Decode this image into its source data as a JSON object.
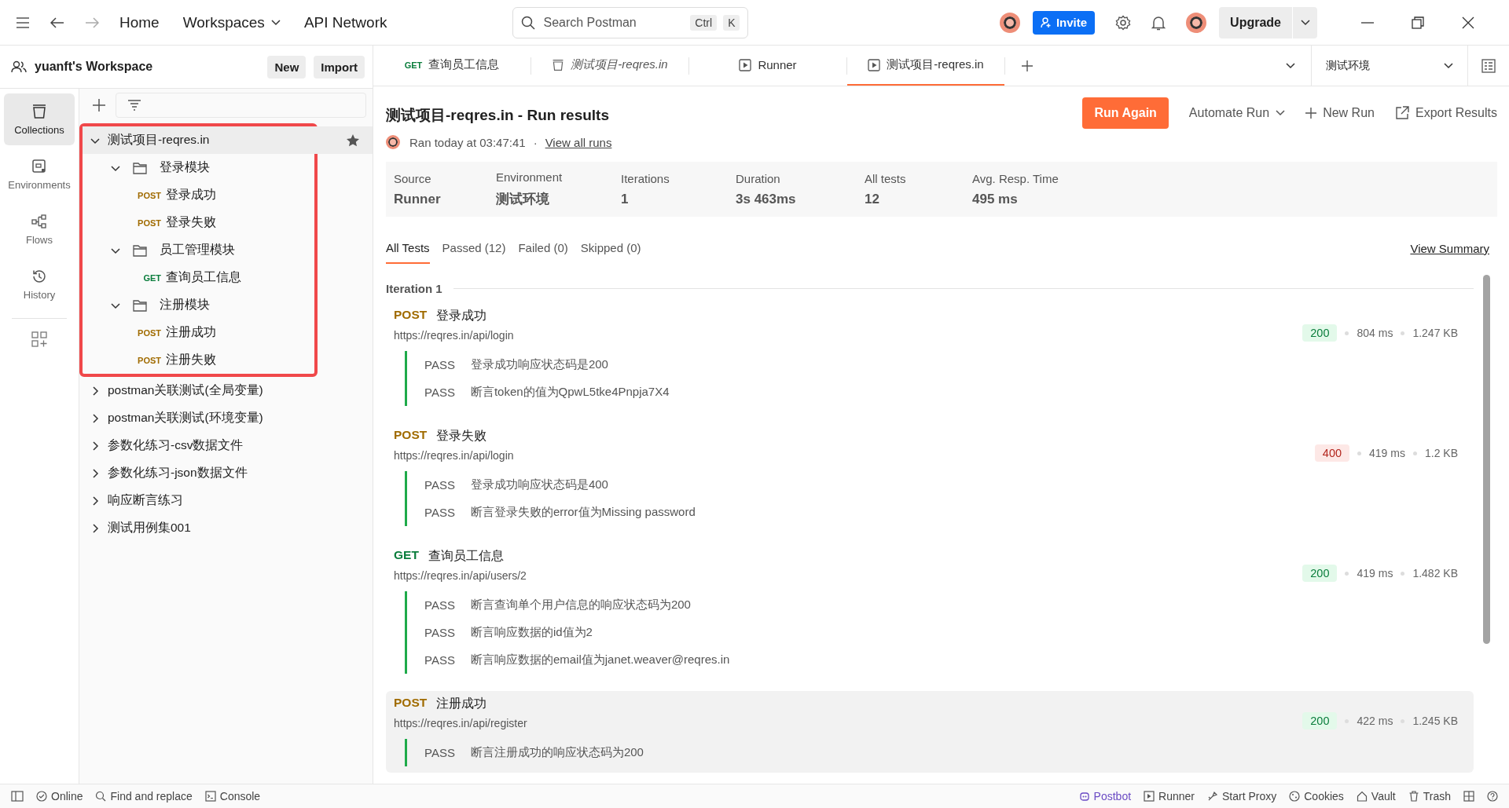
{
  "topbar": {
    "nav": [
      "Home",
      "Workspaces",
      "API Network"
    ],
    "search": {
      "placeholder": "Search Postman",
      "keys": [
        "Ctrl",
        "K"
      ]
    },
    "invite": "Invite",
    "upgrade": "Upgrade"
  },
  "workspace": {
    "name": "yuanft's Workspace",
    "buttons": [
      "New",
      "Import"
    ]
  },
  "rail": [
    {
      "label": "Collections",
      "selected": true,
      "kind": "collections"
    },
    {
      "label": "Environments",
      "selected": false,
      "kind": "environments"
    },
    {
      "label": "Flows",
      "selected": false,
      "kind": "flows"
    },
    {
      "label": "History",
      "selected": false,
      "kind": "history"
    }
  ],
  "collections": [
    {
      "name": "测试项目-reqres.in",
      "expanded": true,
      "highlighted": true,
      "starred": true,
      "children": [
        {
          "kind": "folder",
          "name": "登录模块",
          "expanded": true,
          "children": [
            {
              "kind": "request",
              "method": "POST",
              "name": "登录成功"
            },
            {
              "kind": "request",
              "method": "POST",
              "name": "登录失败"
            }
          ]
        },
        {
          "kind": "folder",
          "name": "员工管理模块",
          "expanded": true,
          "children": [
            {
              "kind": "request",
              "method": "GET",
              "name": "查询员工信息"
            }
          ]
        },
        {
          "kind": "folder",
          "name": "注册模块",
          "expanded": true,
          "children": [
            {
              "kind": "request",
              "method": "POST",
              "name": "注册成功"
            },
            {
              "kind": "request",
              "method": "POST",
              "name": "注册失败"
            }
          ]
        }
      ]
    },
    {
      "name": "postman关联测试(全局变量)",
      "expanded": false,
      "highlighted": false,
      "starred": false
    },
    {
      "name": "postman关联测试(环境变量)",
      "expanded": false,
      "highlighted": false,
      "starred": false
    },
    {
      "name": "参数化练习-csv数据文件",
      "expanded": false,
      "highlighted": false,
      "starred": false
    },
    {
      "name": "参数化练习-json数据文件",
      "expanded": false,
      "highlighted": false,
      "starred": false
    },
    {
      "name": "响应断言练习",
      "expanded": false,
      "highlighted": false,
      "starred": false
    },
    {
      "name": "测试用例集001",
      "expanded": false,
      "highlighted": false,
      "starred": false
    }
  ],
  "tabs": [
    {
      "kind": "request",
      "method": "GET",
      "title": "查询员工信息",
      "preview": false,
      "selected": false
    },
    {
      "kind": "collection",
      "title": "测试项目-reqres.in",
      "preview": true,
      "selected": false
    },
    {
      "kind": "runner",
      "title": "Runner",
      "preview": false,
      "selected": false
    },
    {
      "kind": "runner",
      "title": "测试项目-reqres.in",
      "preview": false,
      "selected": true
    }
  ],
  "environment": "测试环境",
  "run": {
    "title": "测试项目-reqres.in - Run results",
    "ran": "Ran today at 03:47:41",
    "separator": "·",
    "view_all": "View all runs",
    "actions": {
      "run_again": "Run Again",
      "automate": "Automate Run",
      "new_run": "New Run",
      "export": "Export Results"
    },
    "summary": [
      {
        "label": "Source",
        "value": "Runner"
      },
      {
        "label": "Environment",
        "value": "测试环境"
      },
      {
        "label": "Iterations",
        "value": "1"
      },
      {
        "label": "Duration",
        "value": "3s 463ms"
      },
      {
        "label": "All tests",
        "value": "12"
      },
      {
        "label": "Avg. Resp. Time",
        "value": "495 ms"
      }
    ],
    "filters": [
      {
        "label": "All Tests",
        "selected": true
      },
      {
        "label": "Passed (12)",
        "selected": false
      },
      {
        "label": "Failed (0)",
        "selected": false
      },
      {
        "label": "Skipped (0)",
        "selected": false
      }
    ],
    "view_summary": "View Summary",
    "iteration": "Iteration 1",
    "results": [
      {
        "method": "POST",
        "name": "登录成功",
        "url": "https://reqres.in/api/login",
        "status": "200",
        "kind": "ok",
        "time": "804 ms",
        "size": "1.247 KB",
        "hovered": false,
        "tests": [
          {
            "result": "PASS",
            "text": "登录成功响应状态码是200"
          },
          {
            "result": "PASS",
            "text": "断言token的值为QpwL5tke4Pnpja7X4"
          }
        ]
      },
      {
        "method": "POST",
        "name": "登录失败",
        "url": "https://reqres.in/api/login",
        "status": "400",
        "kind": "error",
        "time": "419 ms",
        "size": "1.2 KB",
        "hovered": false,
        "tests": [
          {
            "result": "PASS",
            "text": "登录成功响应状态码是400"
          },
          {
            "result": "PASS",
            "text": "断言登录失败的error值为Missing password"
          }
        ]
      },
      {
        "method": "GET",
        "name": "查询员工信息",
        "url": "https://reqres.in/api/users/2",
        "status": "200",
        "kind": "ok",
        "time": "419 ms",
        "size": "1.482 KB",
        "hovered": false,
        "tests": [
          {
            "result": "PASS",
            "text": "断言查询单个用户信息的响应状态码为200"
          },
          {
            "result": "PASS",
            "text": "断言响应数据的id值为2"
          },
          {
            "result": "PASS",
            "text": "断言响应数据的email值为janet.weaver@reqres.in"
          }
        ]
      },
      {
        "method": "POST",
        "name": "注册成功",
        "url": "https://reqres.in/api/register",
        "status": "200",
        "kind": "ok",
        "time": "422 ms",
        "size": "1.245 KB",
        "hovered": true,
        "tests": [
          {
            "result": "PASS",
            "text": "断言注册成功的响应状态码为200"
          }
        ]
      }
    ]
  },
  "statusbar": {
    "left": [
      "Online",
      "Find and replace",
      "Console"
    ],
    "right": [
      "Postbot",
      "Runner",
      "Start Proxy",
      "Cookies",
      "Vault",
      "Trash"
    ]
  }
}
